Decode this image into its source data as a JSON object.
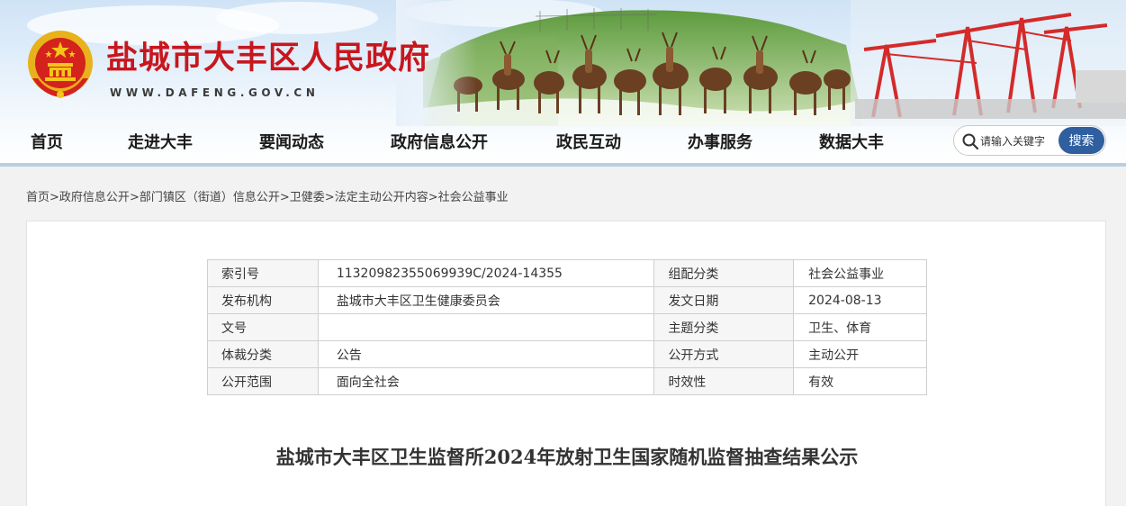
{
  "header": {
    "title": "盐城市大丰区人民政府",
    "domain": "WWW.DAFENG.GOV.CN",
    "title_color": "#c8161d"
  },
  "nav": {
    "items": [
      {
        "label": "首页"
      },
      {
        "label": "走进大丰"
      },
      {
        "label": "要闻动态"
      },
      {
        "label": "政府信息公开"
      },
      {
        "label": "政民互动"
      },
      {
        "label": "办事服务"
      },
      {
        "label": "数据大丰"
      }
    ]
  },
  "search": {
    "placeholder": "请输入关键字",
    "button_label": "搜索",
    "button_color": "#2f5f9e"
  },
  "breadcrumb": {
    "items": [
      "首页",
      "政府信息公开",
      "部门镇区（街道）信息公开",
      "卫健委",
      "法定主动公开内容",
      "社会公益事业"
    ],
    "separator": ">"
  },
  "meta": {
    "rows": [
      [
        {
          "label": "索引号",
          "value": "11320982355069939C/2024-14355"
        },
        {
          "label": "组配分类",
          "value": "社会公益事业"
        }
      ],
      [
        {
          "label": "发布机构",
          "value": "盐城市大丰区卫生健康委员会"
        },
        {
          "label": "发文日期",
          "value": "2024-08-13"
        }
      ],
      [
        {
          "label": "文号",
          "value": ""
        },
        {
          "label": "主题分类",
          "value": "卫生、体育"
        }
      ],
      [
        {
          "label": "体裁分类",
          "value": "公告"
        },
        {
          "label": "公开方式",
          "value": "主动公开"
        }
      ],
      [
        {
          "label": "公开范围",
          "value": "面向全社会"
        },
        {
          "label": "时效性",
          "value": "有效"
        }
      ]
    ]
  },
  "article": {
    "title": "盐城市大丰区卫生监督所2024年放射卫生国家随机监督抽查结果公示"
  },
  "icons": {
    "emblem": "national-emblem-icon",
    "search": "search-icon",
    "banner": "elk-herd-and-port-cranes-banner"
  }
}
